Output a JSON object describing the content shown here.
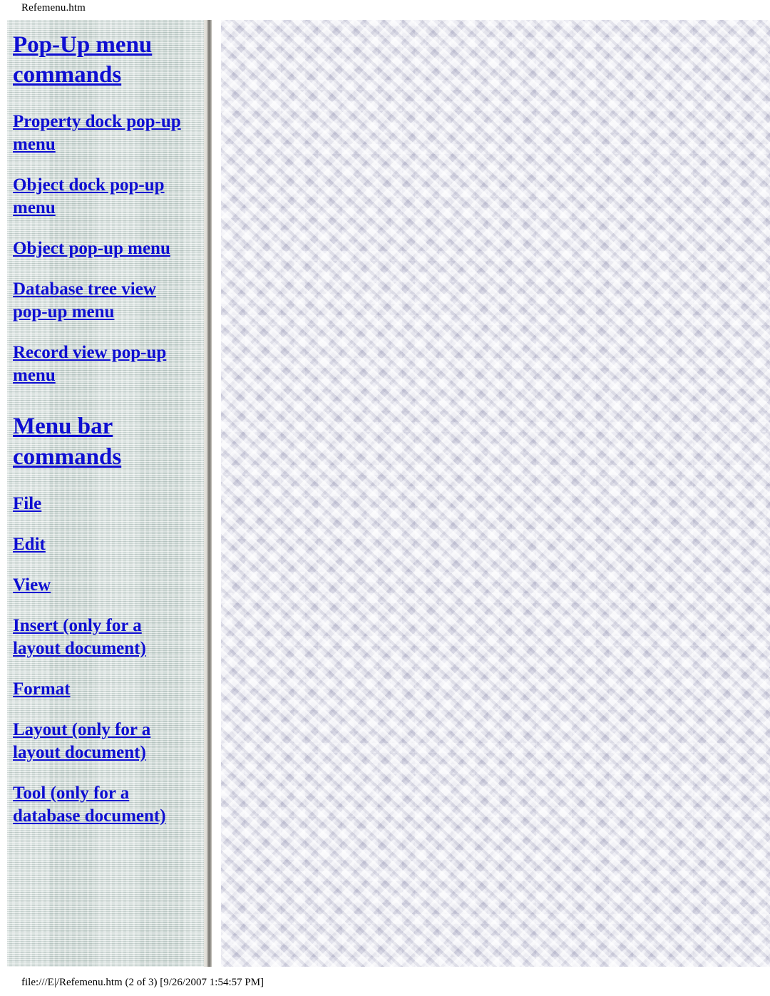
{
  "page": {
    "header_title": "Refemenu.htm",
    "footer_text": "file:///E|/Refemenu.htm (2 of 3) [9/26/2007 1:54:57 PM]",
    "link_color": "#0e0ed2",
    "nav_background_color": "#ccd8d4",
    "content_background_color": "#dcdce9"
  },
  "nav": {
    "sections": [
      {
        "heading": "Pop-Up menu commands",
        "items": [
          "Property dock pop-up menu",
          "Object dock pop-up menu",
          "Object pop-up menu",
          "Database tree view pop-up menu",
          "Record view pop-up menu"
        ]
      },
      {
        "heading": "Menu bar commands",
        "items": [
          "File",
          "Edit",
          "View",
          "Insert (only for a layout document)",
          "Format",
          "Layout (only for a layout document)",
          "Tool (only for a database document)"
        ]
      }
    ]
  },
  "content": {
    "body_text": ""
  }
}
